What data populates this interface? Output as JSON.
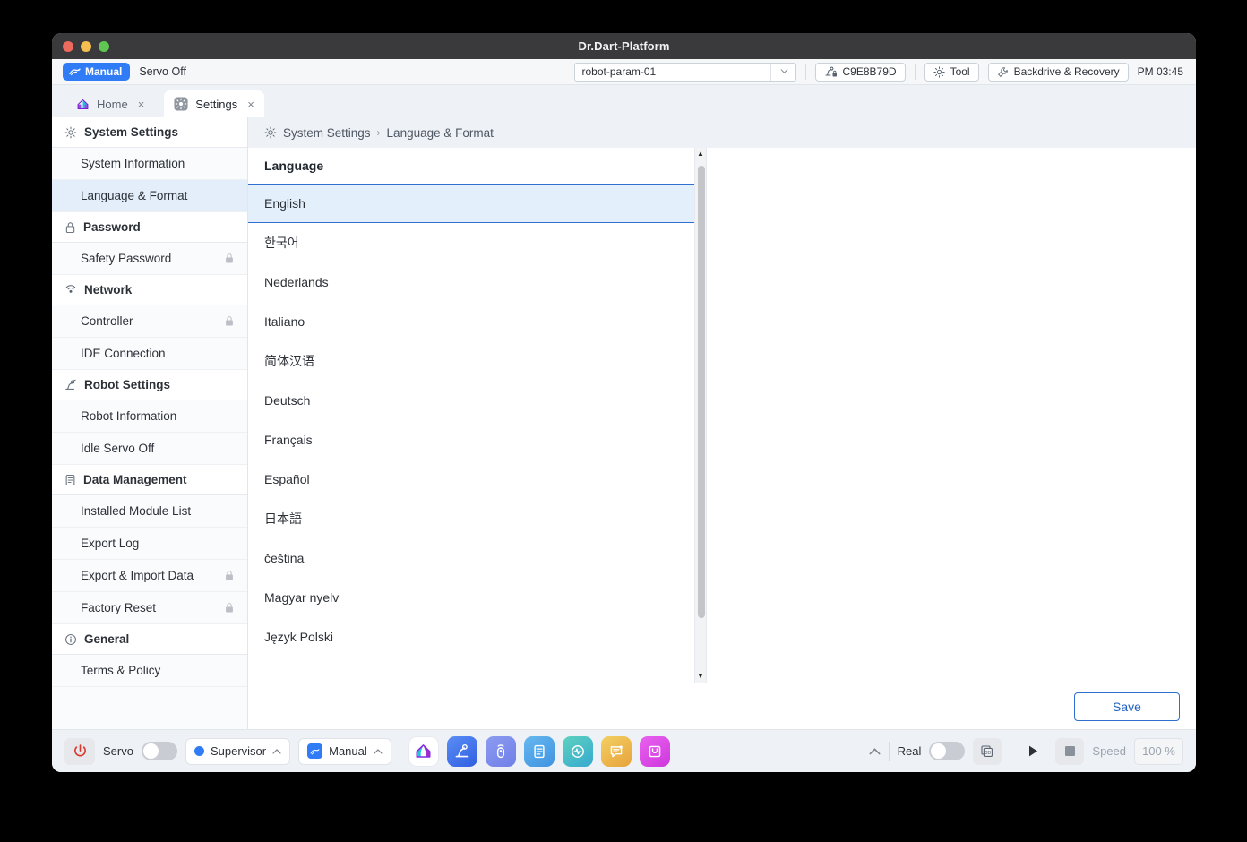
{
  "window": {
    "title": "Dr.Dart-Platform"
  },
  "statusbar": {
    "mode_badge": "Manual",
    "servo_state": "Servo Off",
    "param_value": "robot-param-01",
    "robot_id": "C9E8B79D",
    "tool_label": "Tool",
    "backdrive_label": "Backdrive & Recovery",
    "clock": "PM 03:45"
  },
  "tabs": [
    {
      "label": "Home",
      "icon": "home-icon",
      "active": false,
      "close": "×"
    },
    {
      "label": "Settings",
      "icon": "gear-icon",
      "active": true,
      "close": "×"
    }
  ],
  "sidebar": {
    "groups": [
      {
        "header": "System Settings",
        "icon": "gear-icon",
        "items": [
          {
            "label": "System Information",
            "locked": false,
            "selected": false
          },
          {
            "label": "Language & Format",
            "locked": false,
            "selected": true
          }
        ]
      },
      {
        "header": "Password",
        "icon": "lock-icon",
        "items": [
          {
            "label": "Safety Password",
            "locked": true,
            "selected": false
          }
        ]
      },
      {
        "header": "Network",
        "icon": "signal-icon",
        "items": [
          {
            "label": "Controller",
            "locked": true,
            "selected": false
          },
          {
            "label": "IDE Connection",
            "locked": false,
            "selected": false
          }
        ]
      },
      {
        "header": "Robot Settings",
        "icon": "robot-arm-icon",
        "items": [
          {
            "label": "Robot Information",
            "locked": false,
            "selected": false
          },
          {
            "label": "Idle Servo Off",
            "locked": false,
            "selected": false
          }
        ]
      },
      {
        "header": "Data Management",
        "icon": "document-icon",
        "items": [
          {
            "label": "Installed Module List",
            "locked": false,
            "selected": false
          },
          {
            "label": "Export Log",
            "locked": false,
            "selected": false
          },
          {
            "label": "Export & Import Data",
            "locked": true,
            "selected": false
          },
          {
            "label": "Factory Reset",
            "locked": true,
            "selected": false
          }
        ]
      },
      {
        "header": "General",
        "icon": "info-icon",
        "items": [
          {
            "label": "Terms & Policy",
            "locked": false,
            "selected": false
          }
        ]
      }
    ]
  },
  "breadcrumb": {
    "icon": "gear-icon",
    "root": "System Settings",
    "separator": "›",
    "leaf": "Language & Format"
  },
  "content": {
    "list_title": "Language",
    "languages": [
      {
        "label": "English",
        "selected": true
      },
      {
        "label": "한국어",
        "selected": false
      },
      {
        "label": "Nederlands",
        "selected": false
      },
      {
        "label": "Italiano",
        "selected": false
      },
      {
        "label": "简体汉语",
        "selected": false
      },
      {
        "label": "Deutsch",
        "selected": false
      },
      {
        "label": "Français",
        "selected": false
      },
      {
        "label": "Español",
        "selected": false
      },
      {
        "label": "日本語",
        "selected": false
      },
      {
        "label": "čeština",
        "selected": false
      },
      {
        "label": "Magyar nyelv",
        "selected": false
      },
      {
        "label": "Język Polski",
        "selected": false
      }
    ],
    "save_label": "Save"
  },
  "bottombar": {
    "power_icon": "power-icon",
    "servo_label": "Servo",
    "servo_on": false,
    "supervisor_label": "Supervisor",
    "manual_label": "Manual",
    "real_label": "Real",
    "real_on": false,
    "view_3d_label": "3D",
    "play_label": "▶",
    "stop_label": "■",
    "speed_label": "Speed",
    "speed_value": "100 %",
    "app_icons": [
      "home-app-icon",
      "robot-arm-app-icon",
      "teach-pendant-app-icon",
      "task-editor-app-icon",
      "monitoring-app-icon",
      "log-app-icon",
      "package-app-icon"
    ]
  },
  "colors": {
    "accent": "#2f7cf6",
    "selected_row_bg": "#e3f0fb",
    "selected_row_border": "#2f6fce",
    "save_text": "#2061c2"
  }
}
